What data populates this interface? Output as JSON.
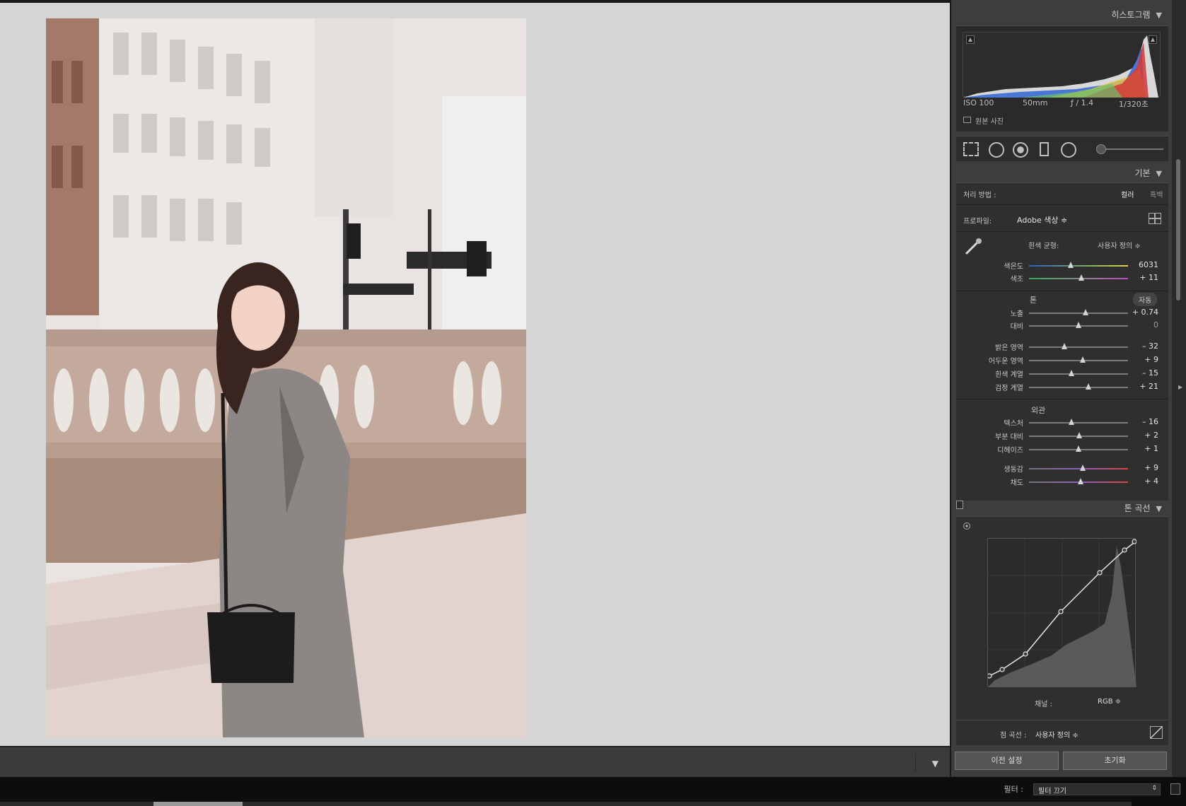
{
  "panel": {
    "histogram": {
      "title": "히스토그램",
      "iso": "ISO 100",
      "focal": "50mm",
      "aperture": "ƒ / 1.4",
      "shutter": "1/320초",
      "original_label": "원본 사진"
    },
    "basic": {
      "title": "기본",
      "treatment_label": "처리 방법 :",
      "treatment_color": "컬러",
      "treatment_bw": "흑백",
      "profile_label": "프로파일:",
      "profile_value": "Adobe 색상 ≑",
      "wb_label": "흰색 균형:",
      "wb_value": "사용자 정의 ≑",
      "temp_label": "색온도",
      "temp_value": "6031",
      "temp_pos": 0.42,
      "tint_label": "색조",
      "tint_value": "+ 11",
      "tint_pos": 0.53,
      "tone_label": "톤",
      "auto_label": "자동",
      "exposure_label": "노출",
      "exposure_value": "+ 0.74",
      "exposure_pos": 0.57,
      "contrast_label": "대비",
      "contrast_value": "0",
      "contrast_pos": 0.5,
      "highlights_label": "밝은 영역",
      "highlights_value": "– 32",
      "highlights_pos": 0.36,
      "shadows_label": "어두운 영역",
      "shadows_value": "+ 9",
      "shadows_pos": 0.54,
      "whites_label": "흰색 계열",
      "whites_value": "– 15",
      "whites_pos": 0.43,
      "blacks_label": "검정 계열",
      "blacks_value": "+ 21",
      "blacks_pos": 0.6,
      "presence_label": "외관",
      "texture_label": "텍스처",
      "texture_value": "– 16",
      "texture_pos": 0.43,
      "clarity_label": "부분 대비",
      "clarity_value": "+ 2",
      "clarity_pos": 0.51,
      "dehaze_label": "디헤이즈",
      "dehaze_value": "+ 1",
      "dehaze_pos": 0.5,
      "vibrance_label": "생동감",
      "vibrance_value": "+ 9",
      "vibrance_pos": 0.54,
      "saturation_label": "채도",
      "saturation_value": "+ 4",
      "saturation_pos": 0.52
    },
    "tone_curve": {
      "title": "톤 곡선",
      "channel_label": "채널 :",
      "channel_value": "RGB ≑",
      "point_curve_label": "점 곡선 :",
      "point_curve_value": "사용자 정의 ≑"
    },
    "buttons": {
      "previous": "이전 설정",
      "reset": "초기화"
    }
  },
  "filmstrip": {
    "filter_label": "필터 :",
    "filter_value": "필터 끄기"
  }
}
